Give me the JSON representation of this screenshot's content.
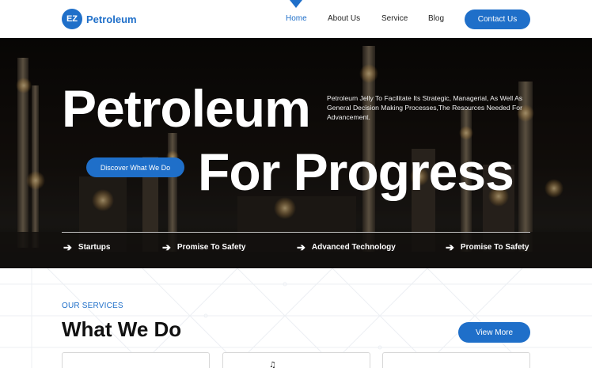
{
  "header": {
    "logo_badge": "EZ",
    "logo_text": "Petroleum",
    "nav": [
      {
        "label": "Home",
        "active": true
      },
      {
        "label": "About Us",
        "active": false
      },
      {
        "label": "Service",
        "active": false
      },
      {
        "label": "Blog",
        "active": false
      }
    ],
    "contact_label": "Contact Us"
  },
  "hero": {
    "title_line1": "Petroleum",
    "title_line2": "For Progress",
    "description": "Petroleum Jelly To Facilitate Its Strategic, Managerial, As Well As General Decision Making Processes,The Resources Needed For Advancement.",
    "cta_label": "Discover What We Do",
    "features": [
      {
        "icon": "arrow-right-icon",
        "label": "Startups"
      },
      {
        "icon": "arrow-right-icon",
        "label": "Promise To Safety"
      },
      {
        "icon": "arrow-right-icon",
        "label": "Advanced Technology"
      },
      {
        "icon": "arrow-right-icon",
        "label": "Promise To Safety"
      }
    ]
  },
  "services": {
    "eyebrow": "OUR SERVICES",
    "title": "What We Do",
    "view_more_label": "View More"
  },
  "colors": {
    "accent": "#1f6fc9",
    "hero_text": "#ffffff",
    "dark_text": "#111111"
  }
}
